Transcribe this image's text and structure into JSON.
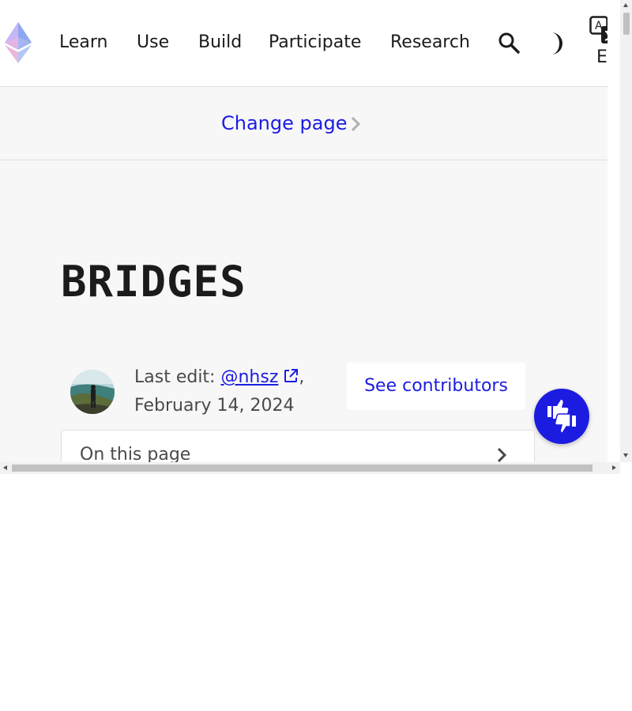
{
  "nav": {
    "items": [
      {
        "label": "Learn"
      },
      {
        "label": "Use"
      },
      {
        "label": "Build"
      },
      {
        "label": "Participate"
      },
      {
        "label": "Research"
      }
    ],
    "language": "EN",
    "icons": {
      "logo": "ethereum-logo",
      "search": "search-icon",
      "theme": "dark-mode-icon",
      "language": "translate-icon"
    }
  },
  "change_page": {
    "label": "Change page"
  },
  "page": {
    "title": "BRIDGES"
  },
  "last_edit": {
    "prefix": "Last edit: ",
    "author": "@nhsz",
    "comma": ",",
    "date": "February 14, 2024"
  },
  "contributors_button": "See contributors",
  "toc": {
    "label": "On this page"
  },
  "colors": {
    "accent": "#1c1ce1",
    "text": "#1b1b1b",
    "muted": "#4a4a4a",
    "background": "#f7f7f7"
  }
}
